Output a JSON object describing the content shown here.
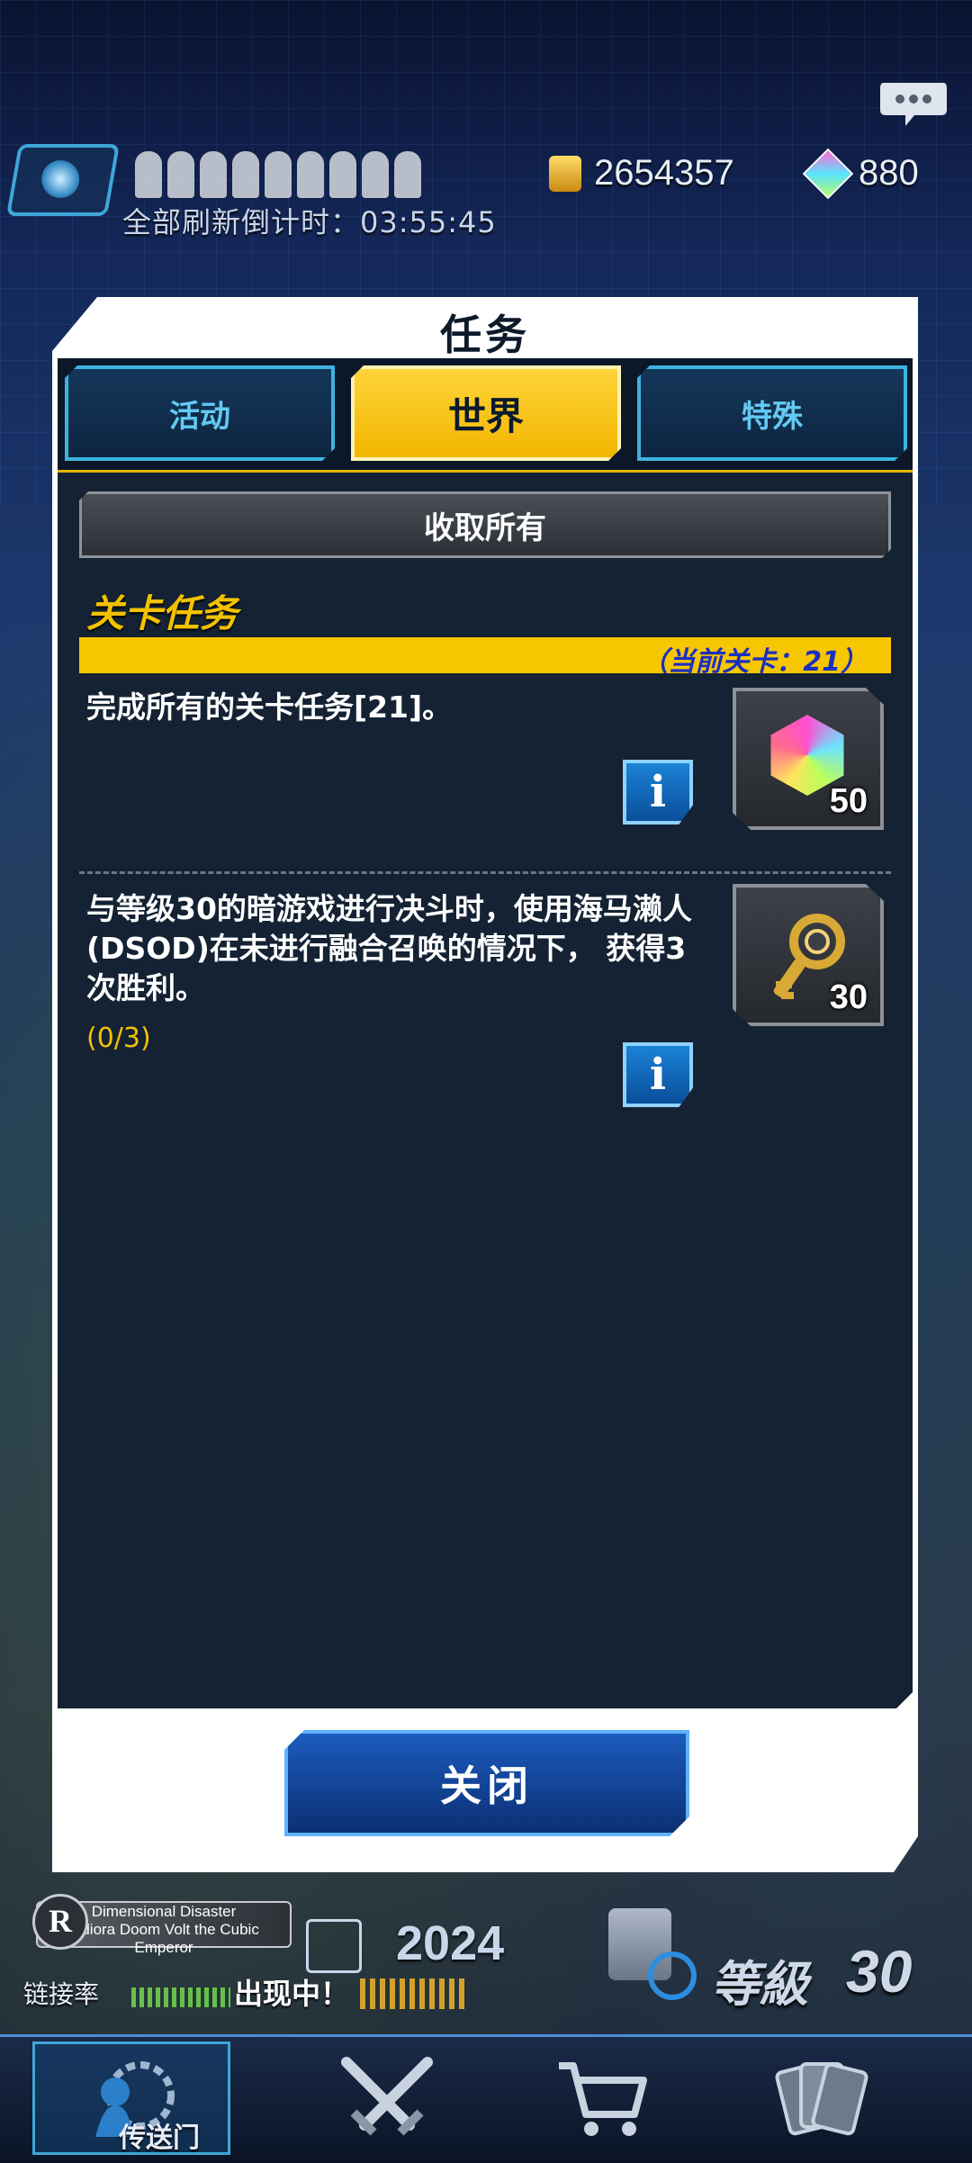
{
  "hud": {
    "refresh_timer": "全部刷新倒计时：03:55:45",
    "gold": "2654357",
    "gems": "880",
    "stamina_slots": 9
  },
  "modal": {
    "title": "任务",
    "tabs": [
      {
        "label": "活动",
        "active": false
      },
      {
        "label": "世界",
        "active": true
      },
      {
        "label": "特殊",
        "active": false
      }
    ],
    "collect_all_label": "收取所有",
    "section": {
      "title": "关卡任务",
      "current_stage": "（当前关卡：21）"
    },
    "missions": [
      {
        "text": "完成所有的关卡任务[21]。",
        "progress": "",
        "reward": {
          "icon": "rainbow-gem-icon",
          "quantity": "50"
        }
      },
      {
        "text": "与等级30的暗游戏进行决斗时，使用海马濑人(DSOD)在未进行融合召唤的情况下， 获得3次胜利。",
        "progress": "(0/3)",
        "reward": {
          "icon": "gold-key-icon",
          "quantity": "30"
        }
      }
    ],
    "info_label": "i",
    "close_label": "关闭"
  },
  "bottom_hud": {
    "deck_badge": "R",
    "deck_name_line1": "Dimensional Disaster",
    "deck_name_line2": "Indiora Doom Volt the Cubic Emperor",
    "deck_count": "2024",
    "link_label": "链接率",
    "appearing_label": "出现中！",
    "level_label": "等級",
    "level_value": "30"
  },
  "nav": {
    "gate_label": "传送门"
  },
  "colors": {
    "accent_yellow": "#f6c600",
    "tab_blue": "#3db3e0",
    "panel": "#142233",
    "stage_text": "#1b2fc0"
  }
}
